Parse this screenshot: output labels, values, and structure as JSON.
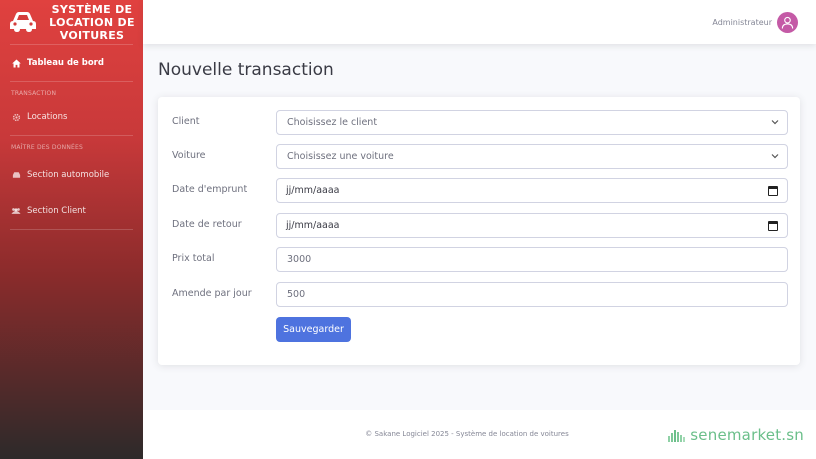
{
  "sidebar": {
    "brand_line1": "SYSTÈME DE",
    "brand_line2": "LOCATION DE",
    "brand_line3": "VOITURES",
    "dashboard_label": "Tableau de bord",
    "heading_transaction": "TRANSACTION",
    "locations_label": "Locations",
    "heading_master_data": "MAÎTRE DES DONNÉES",
    "automobile_label": "Section automobile",
    "client_label": "Section Client"
  },
  "topbar": {
    "username": "Administrateur"
  },
  "main": {
    "page_title": "Nouvelle transaction",
    "form": {
      "client_label": "Client",
      "client_value": "Choisissez le client",
      "voiture_label": "Voiture",
      "voiture_value": "Choisissez une voiture",
      "date_emprunt_label": "Date d'emprunt",
      "date_emprunt_value": "jj/mm/aaaa",
      "date_retour_label": "Date de retour",
      "date_retour_value": "jj/mm/aaaa",
      "prix_total_label": "Prix total",
      "prix_total_value": "3000",
      "amende_label": "Amende par jour",
      "amende_value": "500",
      "save_label": "Sauvegarder"
    }
  },
  "footer": {
    "copyright": "© Sakane Logiciel 2025 - Système de location de voitures",
    "watermark": "senemarket.sn"
  },
  "colors": {
    "sidebar_top": "#e0413f",
    "sidebar_bottom": "#2d2a2a",
    "primary_button": "#4e73df",
    "avatar": "#c45aa6",
    "watermark": "#6bbf8a"
  }
}
